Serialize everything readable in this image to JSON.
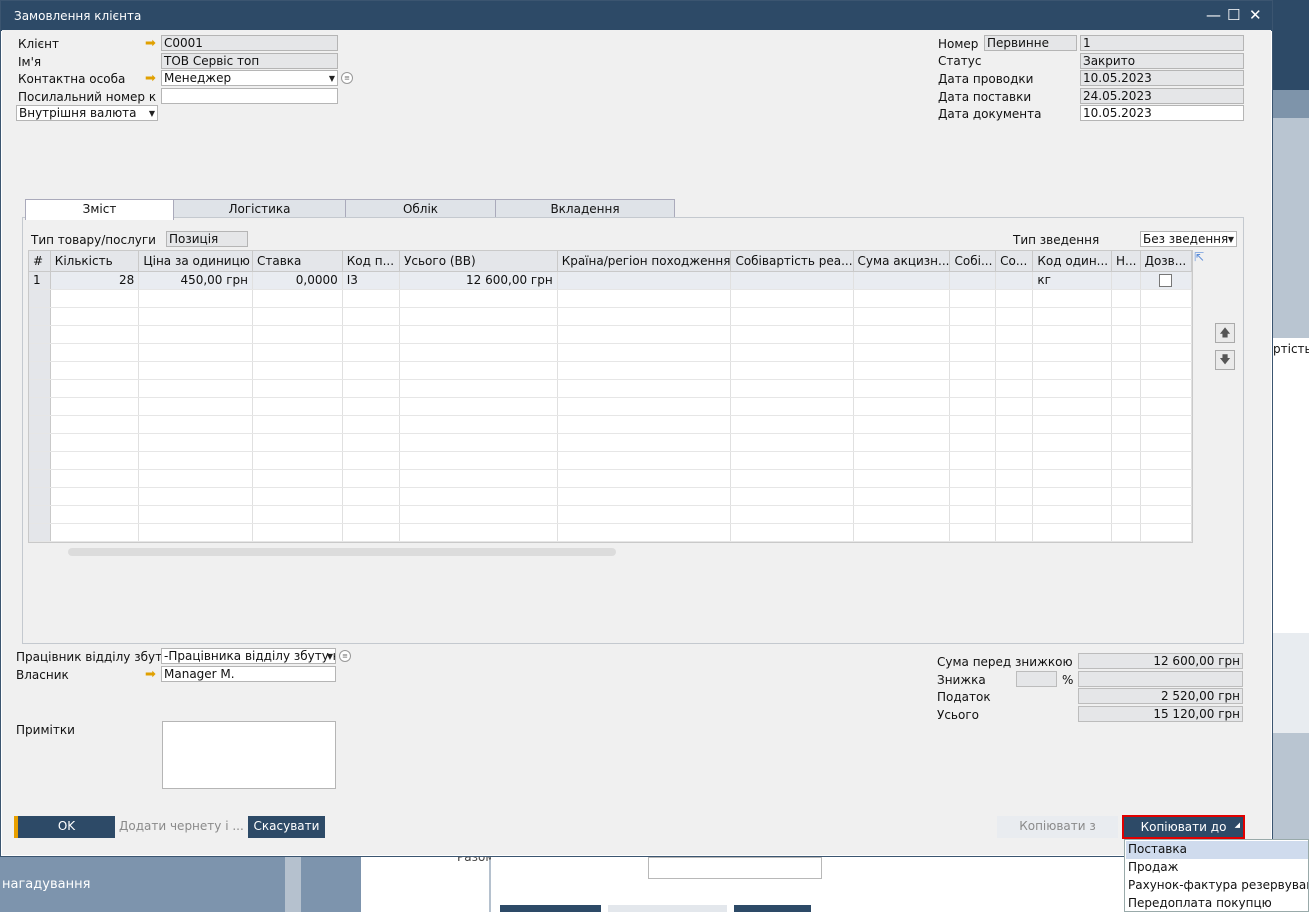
{
  "background": {
    "reminder_text": "нагадування",
    "partial_column_text": "ртість р",
    "partial_label_text": "Разом"
  },
  "window": {
    "title": "Замовлення клієнта",
    "controls": {
      "minimize": "—",
      "maximize": "☐",
      "close": "✕"
    }
  },
  "header_left": {
    "customer_label": "Клієнт",
    "customer_value": "C0001",
    "name_label": "Ім'я",
    "name_value": "ТОВ Сервіс топ",
    "contact_label": "Контактна особа",
    "contact_value": "Менеджер",
    "ref_label": "Посилальний номер к",
    "ref_value": "",
    "currency_value": "Внутрішня валюта"
  },
  "header_right": {
    "number_label": "Номер",
    "number_series": "Первинне",
    "number_value": "1",
    "status_label": "Статус",
    "status_value": "Закрито",
    "posting_date_label": "Дата проводки",
    "posting_date_value": "10.05.2023",
    "delivery_date_label": "Дата поставки",
    "delivery_date_value": "24.05.2023",
    "document_date_label": "Дата документа",
    "document_date_value": "10.05.2023"
  },
  "tabs": [
    "Зміст",
    "Логістика",
    "Облік",
    "Вкладення"
  ],
  "contents": {
    "item_type_label": "Тип товару/послуги",
    "item_type_value": "Позиція",
    "summary_type_label": "Тип зведення",
    "summary_type_value": "Без зведення",
    "columns": [
      "#",
      "Кількість",
      "Ціна за одиницю",
      "Ставка",
      "Код п...",
      "Усього (ВВ)",
      "Країна/регіон походження",
      "Собівартість реа...",
      "Сума акцизн...",
      "Собі...",
      "Со...",
      "Код один...",
      "Н...",
      "Дозв..."
    ],
    "rows": [
      {
        "num": "1",
        "qty": "28",
        "price": "450,00 грн",
        "rate": "0,0000",
        "code": "I3",
        "total": "12 600,00 грн",
        "country": "",
        "cost": "",
        "excise": "",
        "c1": "",
        "c2": "",
        "uom": "кг",
        "n": "",
        "allowed": false
      }
    ]
  },
  "footer_left": {
    "sales_employee_label": "Працівник відділу збуту",
    "sales_employee_value": "-Працівника відділу збуту немає-",
    "owner_label": "Власник",
    "owner_value": "Manager M.",
    "remarks_label": "Примітки"
  },
  "totals": {
    "before_discount_label": "Сума перед знижкою",
    "before_discount_value": "12 600,00 грн",
    "discount_label": "Знижка",
    "discount_percent_sign": "%",
    "discount_pct": "",
    "discount_value": "",
    "tax_label": "Податок",
    "tax_value": "2 520,00 грн",
    "total_label": "Усього",
    "total_value": "15 120,00 грн"
  },
  "buttons": {
    "ok": "OK",
    "add_draft": "Додати чернету і ...",
    "cancel": "Скасувати",
    "copy_from": "Копіювати з",
    "copy_to": "Копіювати до"
  },
  "copy_to_menu": [
    "Поставка",
    "Продаж",
    "Рахунок-фактура резервування",
    "Передоплата покупцю"
  ],
  "colors": {
    "accent": "#2d4a67",
    "highlight_border": "#e10000",
    "selected_menu": "#cfdbed",
    "link_arrow": "#e0a000"
  }
}
